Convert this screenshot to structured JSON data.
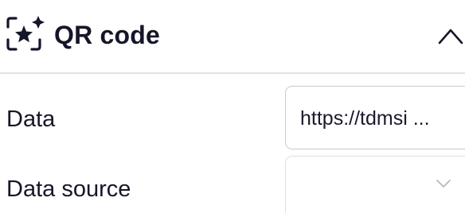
{
  "header": {
    "title": "QR code",
    "icon": "sparkle-frame-icon",
    "collapse_icon": "chevron-up-icon"
  },
  "fields": {
    "data": {
      "label": "Data",
      "value": "https://tdmsi ..."
    },
    "data_source": {
      "label": "Data source",
      "value": "",
      "dropdown_icon": "chevron-down-icon"
    }
  },
  "colors": {
    "text": "#16162a",
    "border": "#c9c9d2",
    "divider": "#e3e3e8"
  }
}
